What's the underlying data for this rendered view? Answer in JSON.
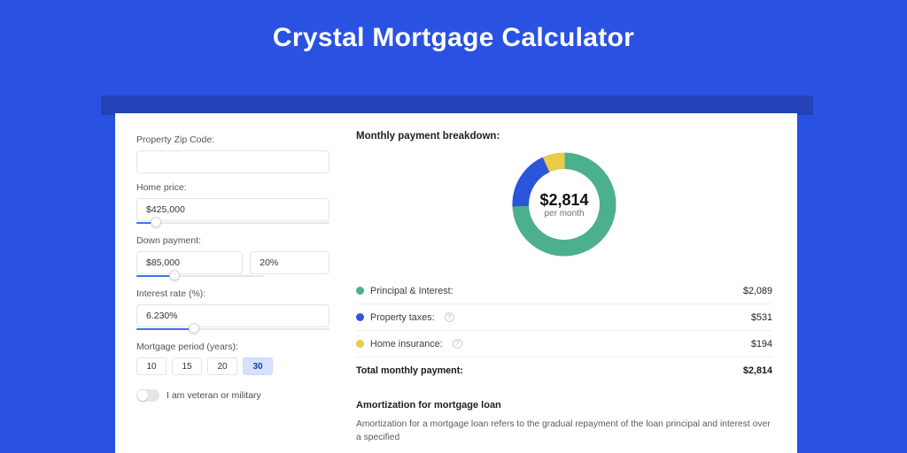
{
  "page_title": "Crystal Mortgage Calculator",
  "form": {
    "zip": {
      "label": "Property Zip Code:",
      "value": ""
    },
    "price": {
      "label": "Home price:",
      "value": "$425,000",
      "slider_fill_pct": 10
    },
    "down": {
      "label": "Down payment:",
      "amount": "$85,000",
      "pct": "20%",
      "slider_fill_pct": 20
    },
    "rate": {
      "label": "Interest rate (%):",
      "value": "6.230%",
      "slider_fill_pct": 30
    },
    "period": {
      "label": "Mortgage period (years):",
      "options": [
        "10",
        "15",
        "20",
        "30"
      ],
      "selected": "30"
    },
    "veteran": {
      "label": "I am veteran or military",
      "on": false
    }
  },
  "breakdown": {
    "heading": "Monthly payment breakdown:",
    "center_value": "$2,814",
    "center_sub": "per month",
    "items": [
      {
        "key": "principal_interest",
        "label": "Principal & Interest:",
        "amount": "$2,089",
        "color": "green",
        "info": false
      },
      {
        "key": "property_taxes",
        "label": "Property taxes:",
        "amount": "$531",
        "color": "blue",
        "info": true
      },
      {
        "key": "home_insurance",
        "label": "Home insurance:",
        "amount": "$194",
        "color": "yellow",
        "info": true
      }
    ],
    "total_label": "Total monthly payment:",
    "total_amount": "$2,814"
  },
  "chart_data": {
    "type": "pie",
    "title": "Monthly payment breakdown:",
    "series": [
      {
        "name": "Principal & Interest",
        "value": 2089,
        "color": "#4db08c"
      },
      {
        "name": "Property taxes",
        "value": 531,
        "color": "#2b56db"
      },
      {
        "name": "Home insurance",
        "value": 194,
        "color": "#eacb4a"
      }
    ],
    "center_label": "$2,814 per month",
    "donut": true
  },
  "amortization": {
    "heading": "Amortization for mortgage loan",
    "body_line1": "Amortization for a mortgage loan refers to the gradual repayment of the loan principal and interest over a specified"
  }
}
